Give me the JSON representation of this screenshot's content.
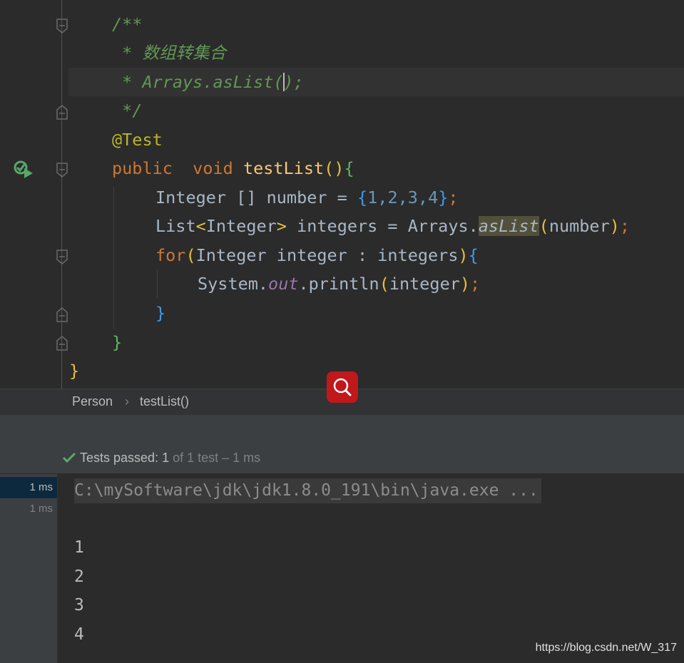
{
  "editor": {
    "lines": [
      [
        "/**"
      ],
      [
        " * 数组转集合"
      ],
      [
        " * Arrays.asList(",
        ");"
      ],
      [
        " */"
      ],
      [
        "@Test"
      ],
      [
        "public",
        "  void ",
        "testList",
        "(",
        ")",
        "{"
      ],
      [
        "Integer [] number = ",
        "{",
        "1",
        ",",
        "2",
        ",",
        "3",
        ",",
        "4",
        "}",
        ";"
      ],
      [
        "List",
        "<",
        "Integer",
        ">",
        " integers = Arrays.",
        "asList",
        "(",
        "number",
        ")",
        ";"
      ],
      [
        "for",
        "(",
        "Integer integer : integers",
        ")",
        "{"
      ],
      [
        "System.",
        "out",
        ".println",
        "(",
        "integer",
        ")",
        ";"
      ],
      [
        "}"
      ],
      [
        "}"
      ],
      [
        "}"
      ]
    ]
  },
  "breadcrumb": {
    "items": [
      "Person",
      "testList()"
    ],
    "separator": "›"
  },
  "tests": {
    "label": "Tests passed:",
    "passed": "1",
    "rest": "of 1 test – 1 ms"
  },
  "results": {
    "times": [
      "1 ms",
      "1 ms"
    ]
  },
  "console": {
    "command": "C:\\mySoftware\\jdk\\jdk1.8.0_191\\bin\\java.exe ...",
    "output": [
      "1",
      "2",
      "3",
      "4"
    ]
  },
  "watermark": "https://blog.csdn.net/W_317",
  "colors": {
    "accent_pass": "#59a869",
    "search_badge": "#c0181b",
    "selection": "#0d293e"
  },
  "icons": [
    "fold-marker-icon",
    "run-test-icon",
    "checkmark-icon",
    "search-icon"
  ]
}
